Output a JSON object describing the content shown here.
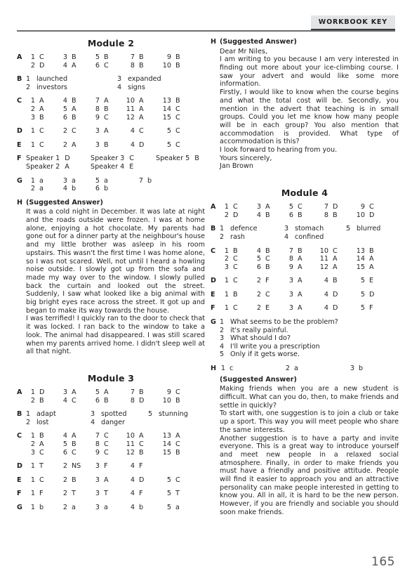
{
  "header": {
    "tab_label": "WORKBOOK KEY"
  },
  "page_number": "165",
  "left_column": {
    "module2": {
      "title": "Module 2",
      "A": {
        "letter": "A",
        "columns": [
          [
            {
              "n": "1",
              "v": "C"
            },
            {
              "n": "2",
              "v": "D"
            }
          ],
          [
            {
              "n": "3",
              "v": "B"
            },
            {
              "n": "4",
              "v": "A"
            }
          ],
          [
            {
              "n": "5",
              "v": "B"
            },
            {
              "n": "6",
              "v": "C"
            }
          ],
          [
            {
              "n": "7",
              "v": "B"
            },
            {
              "n": "8",
              "v": "B"
            }
          ],
          [
            {
              "n": "9",
              "v": "B"
            },
            {
              "n": "10",
              "v": "B"
            }
          ]
        ]
      },
      "B": {
        "letter": "B",
        "columns": [
          [
            {
              "n": "1",
              "v": "launched"
            },
            {
              "n": "2",
              "v": "investors"
            }
          ],
          [
            {
              "n": "3",
              "v": "expanded"
            },
            {
              "n": "4",
              "v": "signs"
            }
          ]
        ]
      },
      "C": {
        "letter": "C",
        "columns": [
          [
            {
              "n": "1",
              "v": "A"
            },
            {
              "n": "2",
              "v": "A"
            },
            {
              "n": "3",
              "v": "B"
            }
          ],
          [
            {
              "n": "4",
              "v": "B"
            },
            {
              "n": "5",
              "v": "A"
            },
            {
              "n": "6",
              "v": "B"
            }
          ],
          [
            {
              "n": "7",
              "v": "A"
            },
            {
              "n": "8",
              "v": "B"
            },
            {
              "n": "9",
              "v": "C"
            }
          ],
          [
            {
              "n": "10",
              "v": "A"
            },
            {
              "n": "11",
              "v": "A"
            },
            {
              "n": "12",
              "v": "A"
            }
          ],
          [
            {
              "n": "13",
              "v": "B"
            },
            {
              "n": "14",
              "v": "C"
            },
            {
              "n": "15",
              "v": "C"
            }
          ]
        ]
      },
      "D": {
        "letter": "D",
        "items": [
          {
            "n": "1",
            "v": "C"
          },
          {
            "n": "2",
            "v": "C"
          },
          {
            "n": "3",
            "v": "A"
          },
          {
            "n": "4",
            "v": "C"
          },
          {
            "n": "5",
            "v": "C"
          }
        ]
      },
      "E": {
        "letter": "E",
        "items": [
          {
            "n": "1",
            "v": "C"
          },
          {
            "n": "2",
            "v": "A"
          },
          {
            "n": "3",
            "v": "B"
          },
          {
            "n": "4",
            "v": "D"
          },
          {
            "n": "5",
            "v": "C"
          }
        ]
      },
      "F": {
        "letter": "F",
        "columns": [
          [
            {
              "n": "Speaker 1",
              "v": "D"
            },
            {
              "n": "Speaker 2",
              "v": "A"
            }
          ],
          [
            {
              "n": "Speaker 3",
              "v": "C"
            },
            {
              "n": "Speaker 4",
              "v": "E"
            }
          ],
          [
            {
              "n": "Speaker 5",
              "v": "B"
            }
          ]
        ]
      },
      "G": {
        "letter": "G",
        "columns": [
          [
            {
              "n": "1",
              "v": "a"
            },
            {
              "n": "2",
              "v": "a"
            }
          ],
          [
            {
              "n": "3",
              "v": "a"
            },
            {
              "n": "4",
              "v": "b"
            }
          ],
          [
            {
              "n": "5",
              "v": "a"
            },
            {
              "n": "6",
              "v": "b"
            }
          ],
          [
            {
              "n": "7",
              "v": "b"
            }
          ]
        ]
      },
      "H": {
        "letter": "H",
        "suggested_label": "(Suggested Answer)",
        "paragraphs": [
          "It was a cold night in December. It was late at night and the roads outside were frozen. I was at home alone, enjoying a hot chocolate. My parents had gone out for a dinner party at the neighbour's house and my little brother was asleep in his room upstairs. This wasn't the first time I was home alone, so I was not scared. Well, not until I heard a howling noise outside. I slowly got up from the sofa and made my way over to the window. I slowly pulled back the curtain and looked out the street. Suddenly, I saw what looked like a big animal with big bright eyes race across the street. It got up and began to make its way towards the house.",
          "I was terrified! I quickly ran to the door to check that it was locked. I ran back to the window to take a look. The animal had disappeared. I was still scared when my parents arrived home. I didn't sleep well at all that night."
        ]
      }
    },
    "module3": {
      "title": "Module 3",
      "A": {
        "letter": "A",
        "columns": [
          [
            {
              "n": "1",
              "v": "D"
            },
            {
              "n": "2",
              "v": "B"
            }
          ],
          [
            {
              "n": "3",
              "v": "A"
            },
            {
              "n": "4",
              "v": "C"
            }
          ],
          [
            {
              "n": "5",
              "v": "A"
            },
            {
              "n": "6",
              "v": "B"
            }
          ],
          [
            {
              "n": "7",
              "v": "B"
            },
            {
              "n": "8",
              "v": "D"
            }
          ],
          [
            {
              "n": "9",
              "v": "C"
            },
            {
              "n": "10",
              "v": "B"
            }
          ]
        ]
      },
      "B": {
        "letter": "B",
        "columns": [
          [
            {
              "n": "1",
              "v": "adapt"
            },
            {
              "n": "2",
              "v": "lost"
            }
          ],
          [
            {
              "n": "3",
              "v": "spotted"
            },
            {
              "n": "4",
              "v": "danger"
            }
          ],
          [
            {
              "n": "5",
              "v": "stunning"
            }
          ]
        ]
      },
      "C": {
        "letter": "C",
        "columns": [
          [
            {
              "n": "1",
              "v": "B"
            },
            {
              "n": "2",
              "v": "A"
            },
            {
              "n": "3",
              "v": "C"
            }
          ],
          [
            {
              "n": "4",
              "v": "A"
            },
            {
              "n": "5",
              "v": "B"
            },
            {
              "n": "6",
              "v": "C"
            }
          ],
          [
            {
              "n": "7",
              "v": "C"
            },
            {
              "n": "8",
              "v": "C"
            },
            {
              "n": "9",
              "v": "C"
            }
          ],
          [
            {
              "n": "10",
              "v": "A"
            },
            {
              "n": "11",
              "v": "C"
            },
            {
              "n": "12",
              "v": "B"
            }
          ],
          [
            {
              "n": "13",
              "v": "A"
            },
            {
              "n": "14",
              "v": "C"
            },
            {
              "n": "15",
              "v": "B"
            }
          ]
        ]
      },
      "D": {
        "letter": "D",
        "items": [
          {
            "n": "1",
            "v": "T"
          },
          {
            "n": "2",
            "v": "NS"
          },
          {
            "n": "3",
            "v": "F"
          },
          {
            "n": "4",
            "v": "F"
          }
        ]
      },
      "E": {
        "letter": "E",
        "items": [
          {
            "n": "1",
            "v": "C"
          },
          {
            "n": "2",
            "v": "B"
          },
          {
            "n": "3",
            "v": "A"
          },
          {
            "n": "4",
            "v": "D"
          },
          {
            "n": "5",
            "v": "C"
          }
        ]
      },
      "F": {
        "letter": "F",
        "items": [
          {
            "n": "1",
            "v": "F"
          },
          {
            "n": "2",
            "v": "T"
          },
          {
            "n": "3",
            "v": "T"
          },
          {
            "n": "4",
            "v": "F"
          },
          {
            "n": "5",
            "v": "T"
          }
        ]
      },
      "G": {
        "letter": "G",
        "items": [
          {
            "n": "1",
            "v": "b"
          },
          {
            "n": "2",
            "v": "a"
          },
          {
            "n": "3",
            "v": "a"
          },
          {
            "n": "4",
            "v": "b"
          },
          {
            "n": "5",
            "v": "a"
          }
        ]
      }
    }
  },
  "right_column": {
    "module2_continued": {
      "H": {
        "letter": "H",
        "suggested_label": "(Suggested Answer)",
        "paragraphs": [
          "Dear Mr Niles,",
          "I am writing to you because I am very interested in finding out more about your ice-climbing course. I saw your advert and would like some more information.",
          "Firstly, I would like to know when the course begins and what the total cost will be. Secondly, you mention in the advert that teaching is in small groups. Could you let me know how many people will be in each group? You also mention that accommodation is provided. What type of accommodation is this?",
          "I look forward to hearing from you.",
          "Yours sincerely,",
          "Jan Brown"
        ]
      }
    },
    "module4": {
      "title": "Module 4",
      "A": {
        "letter": "A",
        "columns": [
          [
            {
              "n": "1",
              "v": "C"
            },
            {
              "n": "2",
              "v": "D"
            }
          ],
          [
            {
              "n": "3",
              "v": "A"
            },
            {
              "n": "4",
              "v": "B"
            }
          ],
          [
            {
              "n": "5",
              "v": "C"
            },
            {
              "n": "6",
              "v": "B"
            }
          ],
          [
            {
              "n": "7",
              "v": "D"
            },
            {
              "n": "8",
              "v": "B"
            }
          ],
          [
            {
              "n": "9",
              "v": "C"
            },
            {
              "n": "10",
              "v": "D"
            }
          ]
        ]
      },
      "B": {
        "letter": "B",
        "columns": [
          [
            {
              "n": "1",
              "v": "defence"
            },
            {
              "n": "2",
              "v": "rash"
            }
          ],
          [
            {
              "n": "3",
              "v": "stomach"
            },
            {
              "n": "4",
              "v": "confined"
            }
          ],
          [
            {
              "n": "5",
              "v": "blurred"
            }
          ]
        ]
      },
      "C": {
        "letter": "C",
        "columns": [
          [
            {
              "n": "1",
              "v": "B"
            },
            {
              "n": "2",
              "v": "C"
            },
            {
              "n": "3",
              "v": "C"
            }
          ],
          [
            {
              "n": "4",
              "v": "B"
            },
            {
              "n": "5",
              "v": "C"
            },
            {
              "n": "6",
              "v": "B"
            }
          ],
          [
            {
              "n": "7",
              "v": "B"
            },
            {
              "n": "8",
              "v": "A"
            },
            {
              "n": "9",
              "v": "A"
            }
          ],
          [
            {
              "n": "10",
              "v": "C"
            },
            {
              "n": "11",
              "v": "A"
            },
            {
              "n": "12",
              "v": "A"
            }
          ],
          [
            {
              "n": "13",
              "v": "B"
            },
            {
              "n": "14",
              "v": "A"
            },
            {
              "n": "15",
              "v": "A"
            }
          ]
        ]
      },
      "D": {
        "letter": "D",
        "items": [
          {
            "n": "1",
            "v": "C"
          },
          {
            "n": "2",
            "v": "F"
          },
          {
            "n": "3",
            "v": "A"
          },
          {
            "n": "4",
            "v": "B"
          },
          {
            "n": "5",
            "v": "E"
          }
        ]
      },
      "E": {
        "letter": "E",
        "items": [
          {
            "n": "1",
            "v": "B"
          },
          {
            "n": "2",
            "v": "C"
          },
          {
            "n": "3",
            "v": "A"
          },
          {
            "n": "4",
            "v": "D"
          },
          {
            "n": "5",
            "v": "D"
          }
        ]
      },
      "F": {
        "letter": "F",
        "items": [
          {
            "n": "1",
            "v": "C"
          },
          {
            "n": "2",
            "v": "E"
          },
          {
            "n": "3",
            "v": "A"
          },
          {
            "n": "4",
            "v": "D"
          },
          {
            "n": "5",
            "v": "F"
          }
        ]
      },
      "G": {
        "letter": "G",
        "questions": [
          {
            "n": "1",
            "t": "What seems to be the problem?"
          },
          {
            "n": "2",
            "t": "it's really painful."
          },
          {
            "n": "3",
            "t": "What should I do?"
          },
          {
            "n": "4",
            "t": "I'll write you a prescription"
          },
          {
            "n": "5",
            "t": "Only if it gets worse."
          }
        ]
      },
      "H": {
        "letter": "H",
        "items": [
          {
            "n": "1",
            "v": "c"
          },
          {
            "n": "2",
            "v": "a"
          },
          {
            "n": "3",
            "v": "b"
          }
        ],
        "suggested_label": "(Suggested Answer)",
        "paragraphs": [
          "Making friends when you are a new student is difficult. What can you do, then, to make friends and settle in quickly?",
          "To start with, one suggestion is to join a club or take up a sport. This way you will meet people who share the same interests.",
          "Another suggestion is to have a party and invite everyone. This is a great way to introduce yourself and meet new people in a relaxed social atmosphere. Finally, in order to make friends you must have a friendly and positive attitude. People will find it easier to approach you and an attractive personality can make people interested in getting to know you. All in all, it is hard to be the new person. However, if you are friendly and sociable you should soon make friends."
        ]
      }
    }
  }
}
